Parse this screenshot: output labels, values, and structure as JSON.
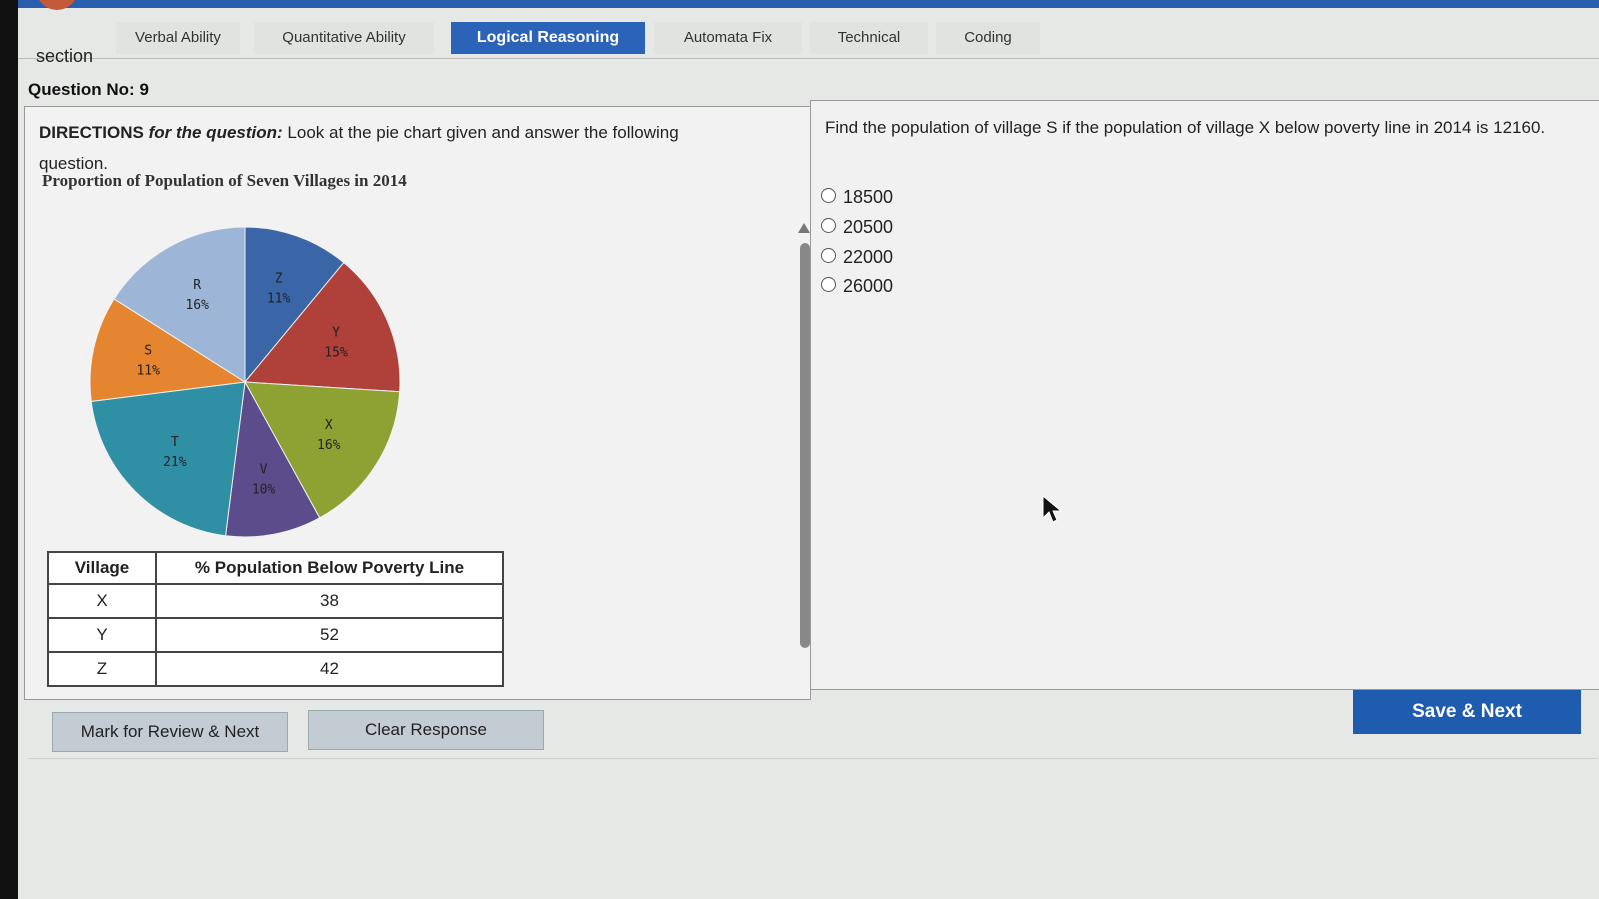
{
  "tabs": {
    "section_label": "section",
    "items": [
      "Verbal Ability",
      "Quantitative Ability",
      "Logical Reasoning",
      "Automata Fix",
      "Technical",
      "Coding"
    ],
    "active": "Logical Reasoning"
  },
  "question_number": "Question No: 9",
  "directions": {
    "lead": "DIRECTIONS",
    "lead_italic": "for the question:",
    "text": "Look at the pie chart given and answer the following question."
  },
  "chart_data": {
    "type": "pie",
    "title": "Proportion of Population of Seven Villages in 2014",
    "slices": [
      {
        "label": "Z",
        "value": 11,
        "color": "#3a66a8"
      },
      {
        "label": "Y",
        "value": 15,
        "color": "#b0403a"
      },
      {
        "label": "X",
        "value": 16,
        "color": "#8ea133"
      },
      {
        "label": "V",
        "value": 10,
        "color": "#5c4c8c"
      },
      {
        "label": "T",
        "value": 21,
        "color": "#2e8fa5"
      },
      {
        "label": "S",
        "value": 11,
        "color": "#e5852f"
      },
      {
        "label": "R",
        "value": 16,
        "color": "#9db6d8"
      }
    ]
  },
  "poverty_table": {
    "headers": [
      "Village",
      "% Population Below Poverty Line"
    ],
    "rows": [
      [
        "X",
        "38"
      ],
      [
        "Y",
        "52"
      ],
      [
        "Z",
        "42"
      ]
    ]
  },
  "question_text": "Find the population of village S if the population of village X below poverty line in 2014 is 12160.",
  "options": [
    "18500",
    "20500",
    "22000",
    "26000"
  ],
  "buttons": {
    "mark_review": "Mark for Review & Next",
    "clear": "Clear Response",
    "save_next": "Save & Next"
  }
}
